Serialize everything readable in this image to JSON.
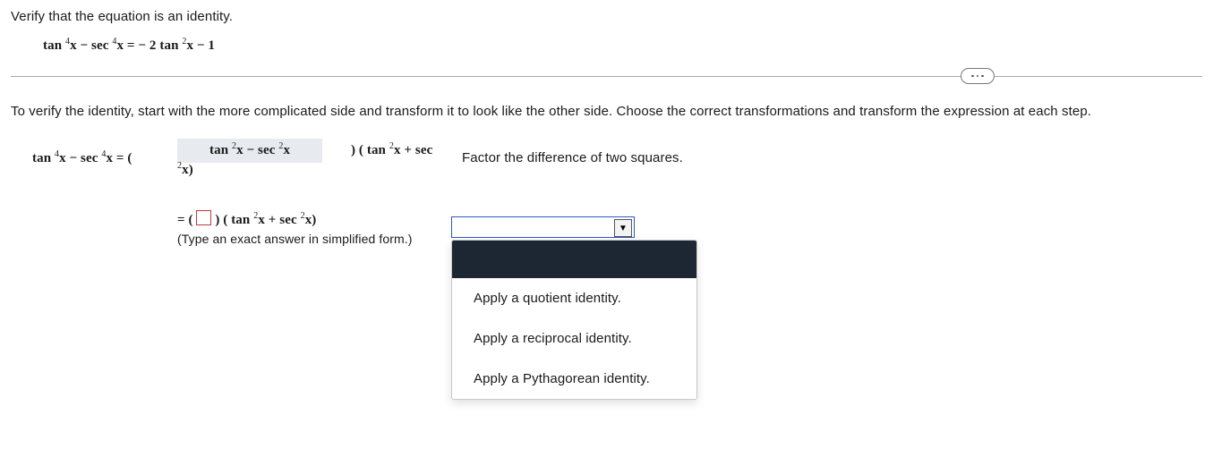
{
  "prompt": "Verify that the equation is an identity.",
  "equation_html": "tan <sup>4</sup>x − sec <sup>4</sup>x = − 2  tan <sup>2</sup>x − 1",
  "divider_label": "more",
  "verify_instruction": "To verify the identity, start with the more complicated side and transform it to look like the other side. Choose the correct transformations and transform the expression at each step.",
  "step1": {
    "lhs_html": "tan <sup>4</sup>x − sec <sup>4</sup>x = (",
    "slot_html": "tan <sup>2</sup>x − sec <sup>2</sup>x",
    "after_slot_html": ") ( tan <sup>2</sup>x + sec <sup>2</sup>x)",
    "explain": "Factor the difference of two squares."
  },
  "step2": {
    "prefix": "= (",
    "after_box_html": ") ( tan <sup>2</sup>x + sec <sup>2</sup>x)",
    "hint": "(Type an exact answer in simplified form.)"
  },
  "dropdown": {
    "selected": "",
    "options": [
      "",
      "Apply a quotient identity.",
      "Apply a reciprocal identity.",
      "Apply a Pythagorean identity."
    ]
  },
  "chart_data": null
}
